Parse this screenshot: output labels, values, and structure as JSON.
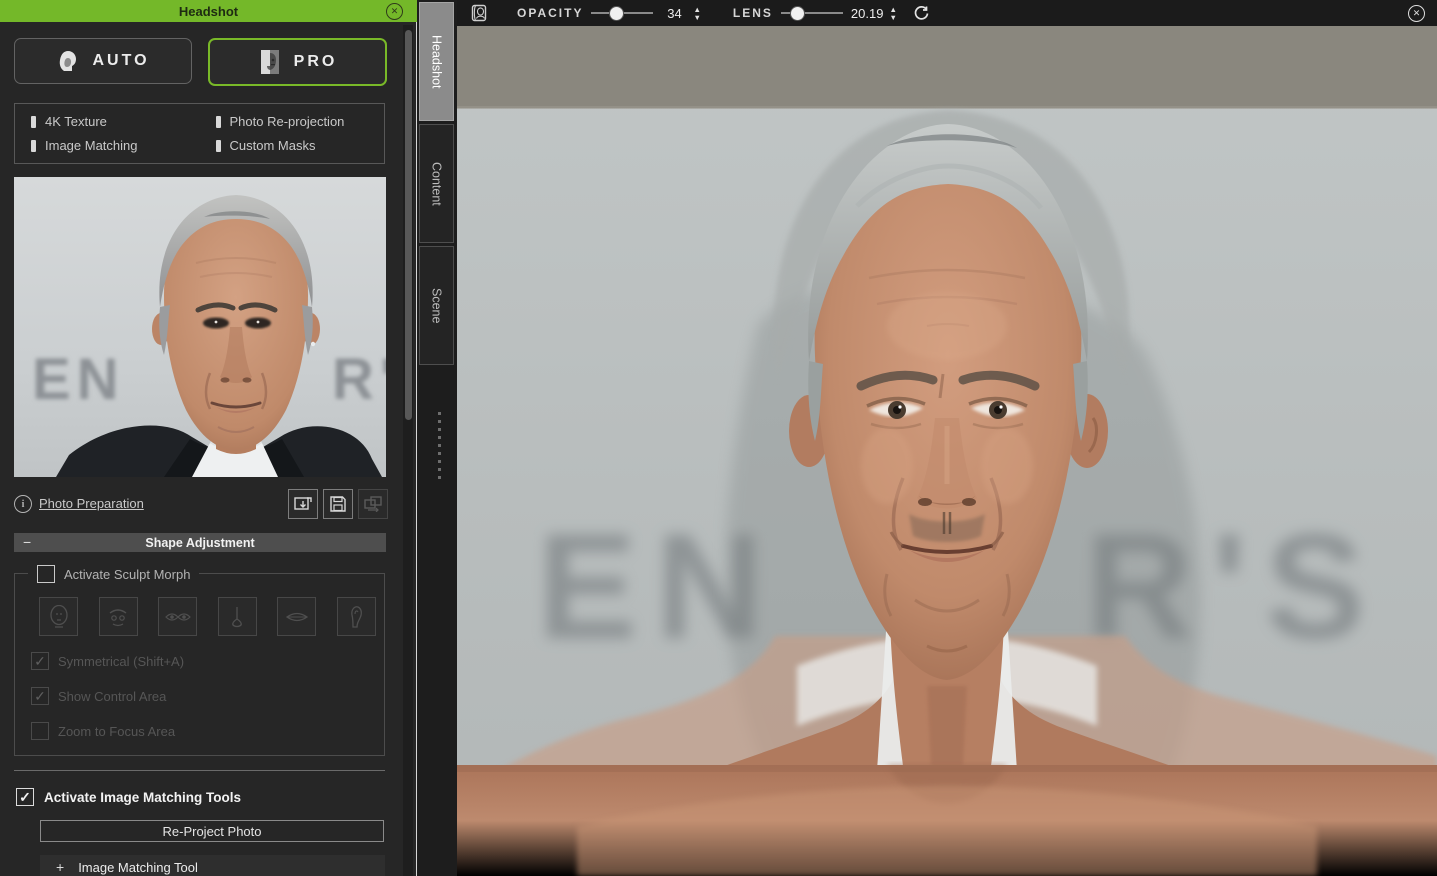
{
  "panel": {
    "title": "Headshot",
    "modes": [
      {
        "label": "AUTO",
        "active": false
      },
      {
        "label": "PRO",
        "active": true
      }
    ],
    "features": [
      "4K Texture",
      "Photo Re-projection",
      "Image Matching",
      "Custom Masks"
    ],
    "photo_preparation": {
      "label": "Photo Preparation"
    },
    "shape_adjustment": {
      "title": "Shape Adjustment",
      "activate_sculpt_label": "Activate Sculpt Morph",
      "sculpt_checked": false,
      "morph_tools": [
        "head",
        "brow",
        "eyes",
        "nose",
        "mouth",
        "ear"
      ],
      "options": [
        {
          "label": "Symmetrical (Shift+A)",
          "checked": true,
          "enabled": false
        },
        {
          "label": "Show Control Area",
          "checked": true,
          "enabled": false
        },
        {
          "label": "Zoom to Focus Area",
          "checked": false,
          "enabled": false
        }
      ]
    },
    "image_matching": {
      "activate_label": "Activate Image Matching Tools",
      "activate_checked": true,
      "reproject_label": "Re-Project Photo",
      "tool_label": "Image Matching Tool"
    }
  },
  "tabs": [
    {
      "label": "Headshot",
      "active": true
    },
    {
      "label": "Content",
      "active": false
    },
    {
      "label": "Scene",
      "active": false
    }
  ],
  "viewport_toolbar": {
    "opacity_label": "OPACITY",
    "opacity_value": "34",
    "lens_label": "LENS",
    "lens_value": "20.19"
  },
  "scene_background_text": {
    "left": "EN",
    "right": "R'S"
  },
  "photo_background_text": {
    "left": "EN",
    "right": "R'"
  },
  "icons": {
    "close": "✕",
    "info": "i",
    "minus": "−",
    "plus": "+",
    "check": "✓",
    "spin_up": "▲",
    "spin_down": "▼"
  },
  "colors": {
    "accent_green": "#74b829",
    "panel_bg": "#262626",
    "toolbar_bg": "#1b1b1b",
    "viewport_band": "#8a877e",
    "viewport_bg": "#b9bebd",
    "skin": "#b57e62"
  }
}
